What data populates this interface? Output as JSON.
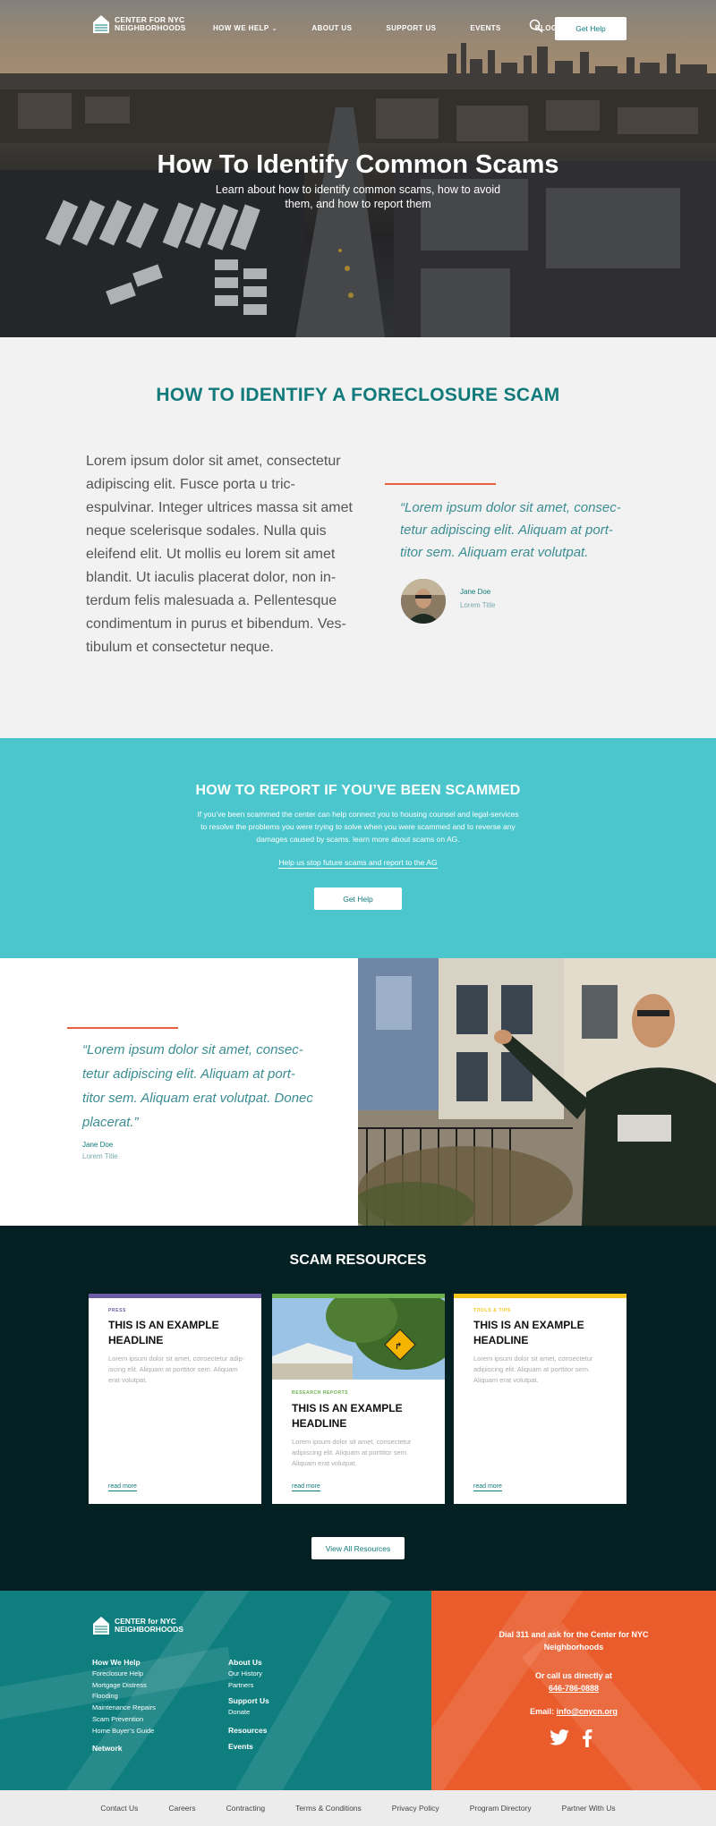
{
  "header": {
    "logo_line1": "CENTER for NYC",
    "logo_line2": "NEIGHBORHOODS",
    "nav": [
      "HOW WE HELP",
      "ABOUT US",
      "SUPPORT US",
      "EVENTS",
      "BLOG"
    ],
    "cta": "Get Help"
  },
  "hero": {
    "title": "How To Identify Common Scams",
    "subtitle": "Learn about how to identify common scams, how to avoid them, and how to report them"
  },
  "side_nav": {
    "active_index": 2,
    "count": 5
  },
  "foreclosure": {
    "heading": "HOW TO IDENTIFY A FORECLOSURE SCAM",
    "body": "Lorem ipsum dolor sit amet, consectetur adipiscing elit. Fusce porta u tric-espulvinar. Integer ultrices massa sit amet neque scelerisque sodales. Nulla quis eleifend elit. Ut mollis eu lorem sit amet blandit. Ut iaculis placerat dolor, non in-terdum felis malesuada a. Pellentesque condimentum in purus et bibendum. Ves-tibulum et consectetur neque.",
    "quote": "“Lorem ipsum dolor sit amet, consec-tetur adipiscing elit. Aliquam at port-titor sem. Aliquam erat volutpat.",
    "author_name": "Jane Doe",
    "author_title": "Lorem Title"
  },
  "report": {
    "heading": "HOW TO REPORT IF YOU’VE BEEN SCAMMED",
    "paragraph": "If you’ve been scammed the center can  help connect you to housing counsel and legal-services to resolve the problems you were  trying to solve when you were scammed and to reverse any damages caused by scams. learn more about scams on AG.",
    "link": "Help us stop future scams and report to the AG",
    "button": "Get Help"
  },
  "testimonial": {
    "quote": "“Lorem ipsum dolor sit amet, consec-tetur adipiscing elit. Aliquam at port-titor sem. Aliquam erat volutpat. Donec placerat.”",
    "author_name": "Jane Doe",
    "author_title": "Lorem Title"
  },
  "resources": {
    "heading": "SCAM RESOURCES",
    "cards": [
      {
        "category": "PRESS",
        "color": "#6b5ca5",
        "headline": "THIS IS AN EXAMPLE HEADLINE",
        "text": "Lorem ipsum dolor sit amet, consectetur adip-iscing elit. Aliquam at porttitor sem.  Aliquam erat volutpat.",
        "more": "read more"
      },
      {
        "category": "RESEARCH REPORTS",
        "color": "#6ab04c",
        "headline": "THIS IS AN EXAMPLE HEADLINE",
        "text": "Lorem ipsum dolor sit amet, consectetur adipiscing elit. Aliquam at porttitor sem. Aliquam erat volutpat.",
        "more": "read more"
      },
      {
        "category": "TOOLS & TIPS",
        "color": "#f5c518",
        "headline": "THIS IS AN EXAMPLE HEADLINE",
        "text": "Lorem ipsum dolor sit amet, consectetur adipiscing elit. Aliquam at porttitor sem. Aliquam erat volutpat.",
        "more": "read more"
      }
    ],
    "view_all": "View All Resources"
  },
  "footer": {
    "col1": {
      "heading": "How We Help",
      "items": [
        "Foreclosure Help",
        "Mortgage Distress",
        "Flooding",
        "Maintenance Repairs",
        "Scam Prevention",
        "Home Buyer’s Guide"
      ],
      "heading2": "Network"
    },
    "col2": {
      "heading": "About Us",
      "items": [
        "Our History",
        "Partners"
      ],
      "heading2": "Support Us",
      "items2": [
        "Donate"
      ],
      "heading3": "Resources",
      "heading4": "Events"
    },
    "contact": {
      "line1": "Dial 311 and ask for the Center for NYC Neighborhoods",
      "line2": "Or call us directly at",
      "phone": "646-786-0888",
      "email_label": "Email:",
      "email": "info@cnycn.org"
    }
  },
  "bottom_links": [
    "Contact Us",
    "Careers",
    "Contracting",
    "Terms & Conditions",
    "Privacy Policy",
    "Program Directory",
    "Partner With Us"
  ]
}
